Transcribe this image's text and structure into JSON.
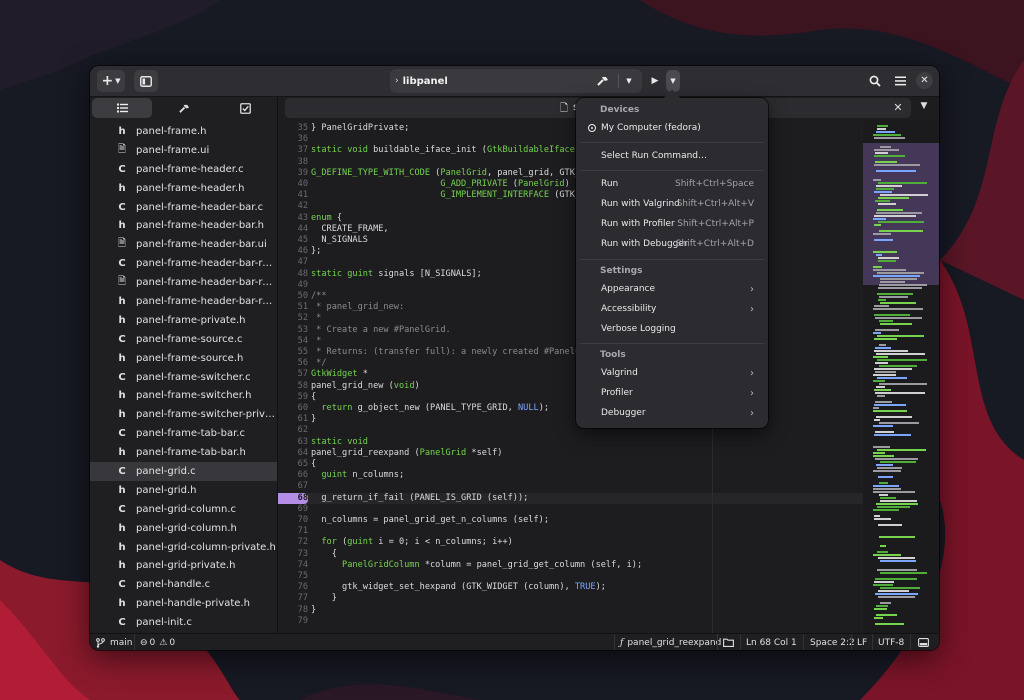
{
  "window": {
    "title": "libpanel"
  },
  "sidebar": {
    "files": [
      {
        "icon": "h",
        "name": "panel-frame.h"
      },
      {
        "icon": "doc",
        "name": "panel-frame.ui"
      },
      {
        "icon": "C",
        "name": "panel-frame-header.c"
      },
      {
        "icon": "h",
        "name": "panel-frame-header.h"
      },
      {
        "icon": "C",
        "name": "panel-frame-header-bar.c"
      },
      {
        "icon": "h",
        "name": "panel-frame-header-bar.h"
      },
      {
        "icon": "doc",
        "name": "panel-frame-header-bar.ui"
      },
      {
        "icon": "C",
        "name": "panel-frame-header-bar-row.c"
      },
      {
        "icon": "doc",
        "name": "panel-frame-header-bar-row.ui"
      },
      {
        "icon": "h",
        "name": "panel-frame-header-bar-row…"
      },
      {
        "icon": "h",
        "name": "panel-frame-private.h"
      },
      {
        "icon": "C",
        "name": "panel-frame-source.c"
      },
      {
        "icon": "h",
        "name": "panel-frame-source.h"
      },
      {
        "icon": "C",
        "name": "panel-frame-switcher.c"
      },
      {
        "icon": "h",
        "name": "panel-frame-switcher.h"
      },
      {
        "icon": "h",
        "name": "panel-frame-switcher-private.h"
      },
      {
        "icon": "C",
        "name": "panel-frame-tab-bar.c"
      },
      {
        "icon": "h",
        "name": "panel-frame-tab-bar.h"
      },
      {
        "icon": "C",
        "name": "panel-grid.c",
        "selected": true
      },
      {
        "icon": "h",
        "name": "panel-grid.h"
      },
      {
        "icon": "C",
        "name": "panel-grid-column.c"
      },
      {
        "icon": "h",
        "name": "panel-grid-column.h"
      },
      {
        "icon": "h",
        "name": "panel-grid-column-private.h"
      },
      {
        "icon": "h",
        "name": "panel-grid-private.h"
      },
      {
        "icon": "C",
        "name": "panel-handle.c"
      },
      {
        "icon": "h",
        "name": "panel-handle-private.h"
      },
      {
        "icon": "C",
        "name": "panel-init.c"
      }
    ]
  },
  "editor": {
    "tab_label": "s",
    "current_line": 68,
    "lines": [
      {
        "n": "35",
        "t": "} PanelGridPrivate;"
      },
      {
        "n": "36",
        "t": ""
      },
      {
        "n": "37",
        "t": "static void buildable_iface_init (GtkBuildableIface *"
      },
      {
        "n": "38",
        "t": ""
      },
      {
        "n": "39",
        "t": "G_DEFINE_TYPE_WITH_CODE (PanelGrid, panel_grid, GTK_T"
      },
      {
        "n": "40",
        "t": "                         G_ADD_PRIVATE (PanelGrid)"
      },
      {
        "n": "41",
        "t": "                         G_IMPLEMENT_INTERFACE (GTK_T"
      },
      {
        "n": "42",
        "t": ""
      },
      {
        "n": "43",
        "t": "enum {"
      },
      {
        "n": "44",
        "t": "  CREATE_FRAME,"
      },
      {
        "n": "45",
        "t": "  N_SIGNALS"
      },
      {
        "n": "46",
        "t": "};"
      },
      {
        "n": "47",
        "t": ""
      },
      {
        "n": "48",
        "t": "static guint signals [N_SIGNALS];"
      },
      {
        "n": "49",
        "t": ""
      },
      {
        "n": "50",
        "t": "/**"
      },
      {
        "n": "51",
        "t": " * panel_grid_new:"
      },
      {
        "n": "52",
        "t": " *"
      },
      {
        "n": "53",
        "t": " * Create a new #PanelGrid."
      },
      {
        "n": "54",
        "t": " *"
      },
      {
        "n": "55",
        "t": " * Returns: (transfer full): a newly created #PanelGr"
      },
      {
        "n": "56",
        "t": " */"
      },
      {
        "n": "57",
        "t": "GtkWidget *"
      },
      {
        "n": "58",
        "t": "panel_grid_new (void)"
      },
      {
        "n": "59",
        "t": "{"
      },
      {
        "n": "60",
        "t": "  return g_object_new (PANEL_TYPE_GRID, NULL);"
      },
      {
        "n": "61",
        "t": "}"
      },
      {
        "n": "62",
        "t": ""
      },
      {
        "n": "63",
        "t": "static void"
      },
      {
        "n": "64",
        "t": "panel_grid_reexpand (PanelGrid *self)"
      },
      {
        "n": "65",
        "t": "{"
      },
      {
        "n": "66",
        "t": "  guint n_columns;"
      },
      {
        "n": "67",
        "t": ""
      },
      {
        "n": "68",
        "t": "  g_return_if_fail (PANEL_IS_GRID (self));"
      },
      {
        "n": "69",
        "t": ""
      },
      {
        "n": "70",
        "t": "  n_columns = panel_grid_get_n_columns (self);"
      },
      {
        "n": "71",
        "t": ""
      },
      {
        "n": "72",
        "t": "  for (guint i = 0; i < n_columns; i++)"
      },
      {
        "n": "73",
        "t": "    {"
      },
      {
        "n": "74",
        "t": "      PanelGridColumn *column = panel_grid_get_column (self, i);"
      },
      {
        "n": "75",
        "t": ""
      },
      {
        "n": "76",
        "t": "      gtk_widget_set_hexpand (GTK_WIDGET (column), TRUE);"
      },
      {
        "n": "77",
        "t": "    }"
      },
      {
        "n": "78",
        "t": "}"
      },
      {
        "n": "79",
        "t": ""
      }
    ]
  },
  "popover": {
    "devices_heading": "Devices",
    "device_item": "My Computer (fedora)",
    "select_run_command": "Select Run Command…",
    "run_items": [
      {
        "label": "Run",
        "accel": "Shift+Ctrl+Space"
      },
      {
        "label": "Run with Valgrind",
        "accel": "Shift+Ctrl+Alt+V"
      },
      {
        "label": "Run with Profiler",
        "accel": "Shift+Ctrl+Alt+P"
      },
      {
        "label": "Run with Debugger",
        "accel": "Shift+Ctrl+Alt+D"
      }
    ],
    "settings_heading": "Settings",
    "settings_items": [
      {
        "label": "Appearance",
        "submenu": true
      },
      {
        "label": "Accessibility",
        "submenu": true
      },
      {
        "label": "Verbose Logging",
        "submenu": false
      }
    ],
    "tools_heading": "Tools",
    "tools_items": [
      {
        "label": "Valgrind"
      },
      {
        "label": "Profiler"
      },
      {
        "label": "Debugger"
      }
    ]
  },
  "statusbar": {
    "branch": "main",
    "errors": "0",
    "warnings": "0",
    "symbol": "panel_grid_reexpand",
    "position": "Ln  68  Col  1",
    "indent": "Space 2:2",
    "line_ending": "LF",
    "encoding": "UTF-8"
  },
  "colors": {
    "accent": "#b48ee6",
    "keyword": "#76d34e",
    "comment": "#8a8a92"
  }
}
